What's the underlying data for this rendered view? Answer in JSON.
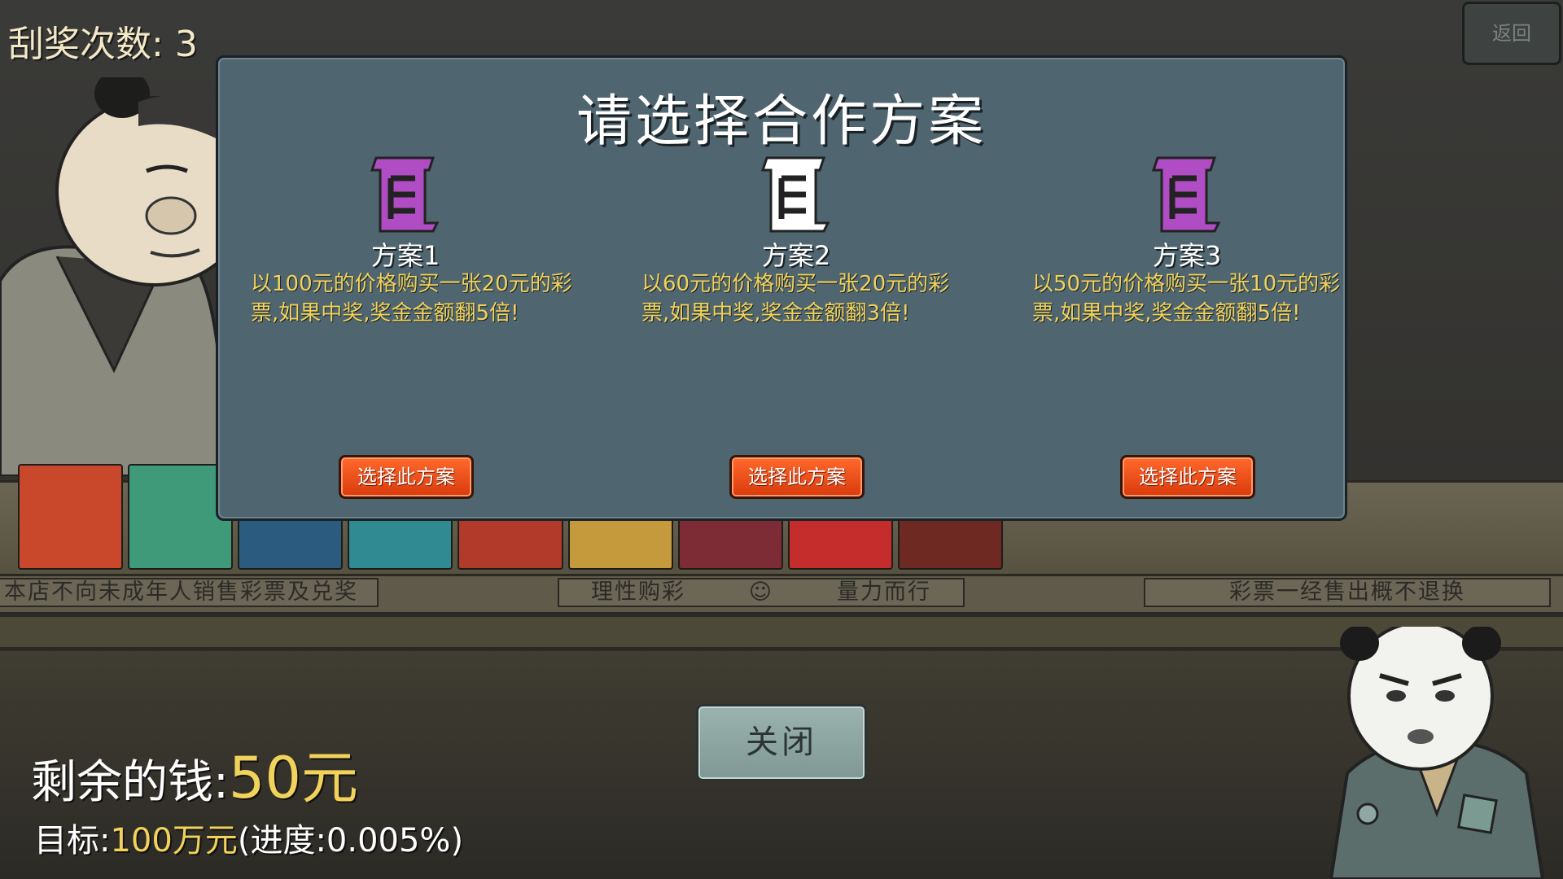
{
  "hud": {
    "scratch_label": "刮奖次数:",
    "scratch_count": "3",
    "back_label": "返回",
    "money_label": "剩余的钱:",
    "money_value": "50元",
    "goal_label": "目标:",
    "goal_value": "100万元",
    "goal_progress": "(进度:0.005%)"
  },
  "signs": {
    "left": "本店不向未成年人销售彩票及兑奖",
    "middle_left": "理性购彩",
    "middle_right": "量力而行",
    "right": "彩票一经售出概不退换"
  },
  "dialog": {
    "title": "请选择合作方案",
    "plans": [
      {
        "name": "方案1",
        "description": "以100元的价格购买一张20元的彩票,如果中奖,奖金金额翻5倍!",
        "button": "选择此方案",
        "icon_color": "#b04cc4"
      },
      {
        "name": "方案2",
        "description": "以60元的价格购买一张20元的彩票,如果中奖,奖金金额翻3倍!",
        "button": "选择此方案",
        "icon_color": "#ffffff"
      },
      {
        "name": "方案3",
        "description": "以50元的价格购买一张10元的彩票,如果中奖,奖金金额翻5倍!",
        "button": "选择此方案",
        "icon_color": "#b04cc4"
      }
    ],
    "close_label": "关闭"
  },
  "colors": {
    "accent_yellow": "#f1d25a",
    "dialog_bg": "#4f6570",
    "button_orange": "#ef4e16"
  }
}
